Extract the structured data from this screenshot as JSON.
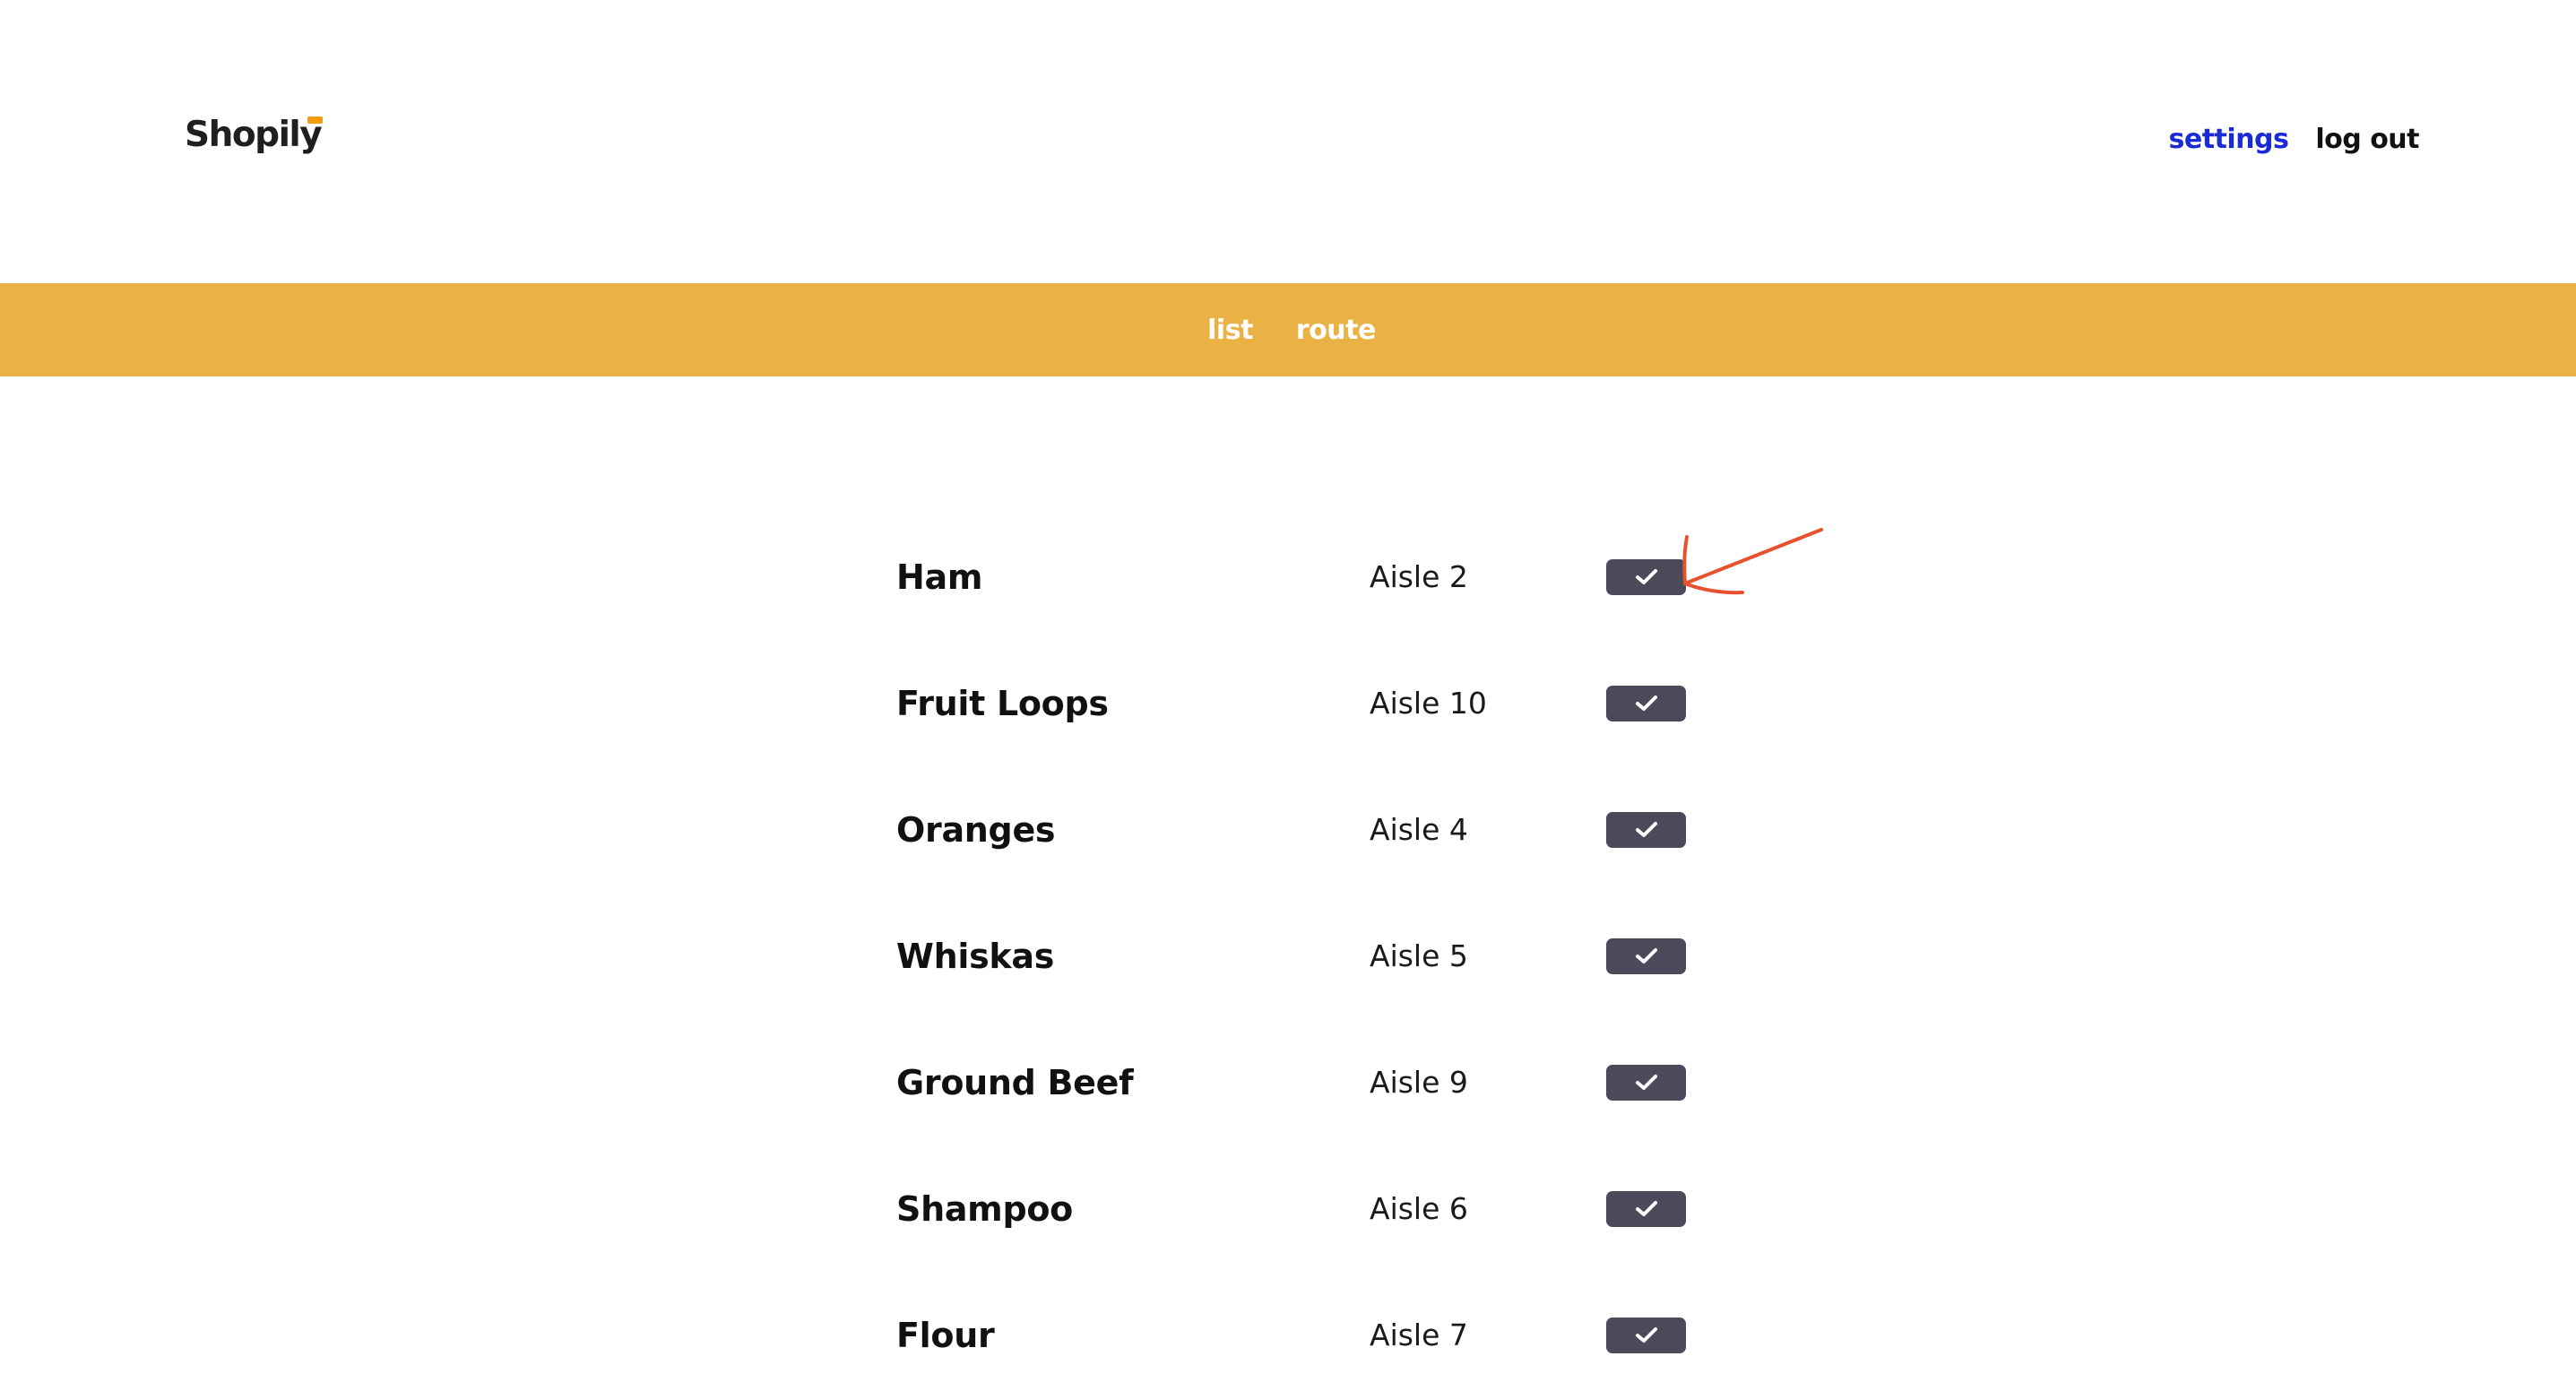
{
  "app": {
    "logo_text": "Shopily",
    "accent_color": "#eab244",
    "link_color": "#1a2bd6",
    "button_color": "#4a4a5a",
    "annotation_color": "#e8512e"
  },
  "header": {
    "settings_label": "settings",
    "logout_label": "log out"
  },
  "tabs": {
    "list_label": "list",
    "route_label": "route"
  },
  "items": [
    {
      "name": "Ham",
      "aisle": "Aisle 2",
      "icon": "check-icon"
    },
    {
      "name": "Fruit Loops",
      "aisle": "Aisle 10",
      "icon": "check-icon"
    },
    {
      "name": "Oranges",
      "aisle": "Aisle 4",
      "icon": "check-icon"
    },
    {
      "name": "Whiskas",
      "aisle": "Aisle 5",
      "icon": "check-icon"
    },
    {
      "name": "Ground Beef",
      "aisle": "Aisle 9",
      "icon": "check-icon"
    },
    {
      "name": "Shampoo",
      "aisle": "Aisle 6",
      "icon": "check-icon"
    },
    {
      "name": "Flour",
      "aisle": "Aisle 7",
      "icon": "check-icon"
    }
  ]
}
